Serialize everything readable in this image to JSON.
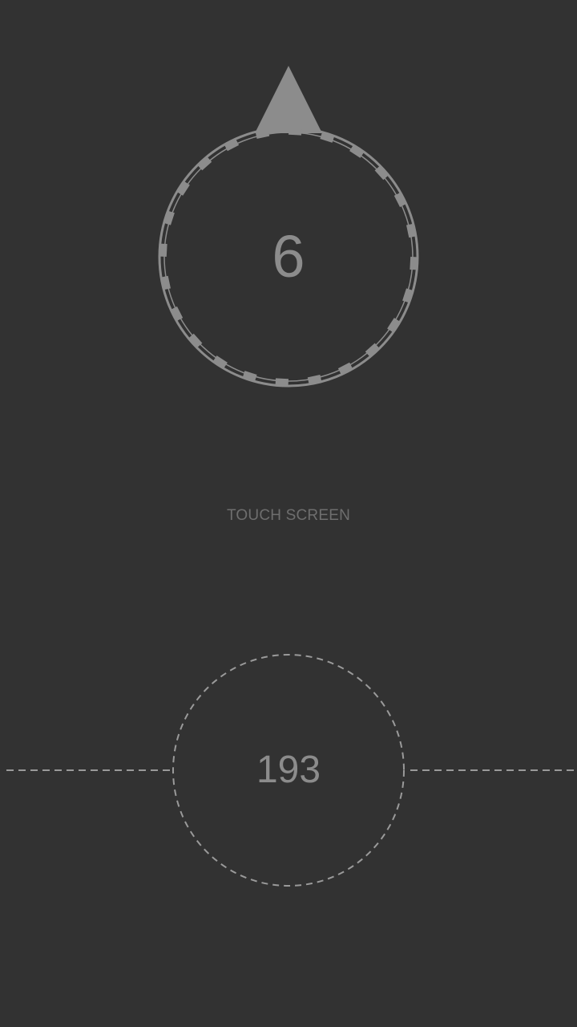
{
  "game": {
    "wheel_count": "6",
    "prompt": "TOUCH SCREEN",
    "score": "193"
  },
  "colors": {
    "background": "#323232",
    "shape_gray": "#8c8c8c",
    "prompt_gray": "#6e6e6e",
    "dash_gray": "#9a9a9a"
  },
  "icons": {
    "pointer": "triangle-pointer-icon",
    "wheel": "toothed-ring-wheel",
    "target": "dashed-target-ring"
  }
}
